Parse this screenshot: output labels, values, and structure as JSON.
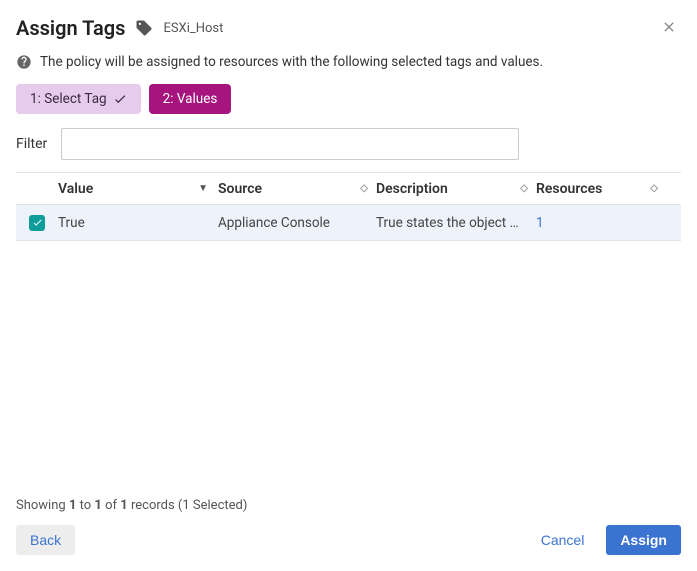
{
  "header": {
    "title": "Assign Tags",
    "tag_name": "ESXi_Host"
  },
  "hint": "The policy will be assigned to resources with the following selected tags and values.",
  "steps": {
    "step1_label": "1: Select Tag",
    "step2_label": "2: Values"
  },
  "filter": {
    "label": "Filter",
    "value": ""
  },
  "columns": {
    "value": "Value",
    "source": "Source",
    "description": "Description",
    "resources": "Resources"
  },
  "rows": [
    {
      "checked": true,
      "value": "True",
      "source": "Appliance Console",
      "description": "True states the object …",
      "resources": "1"
    }
  ],
  "status": {
    "from": "1",
    "to": "1",
    "total": "1",
    "selected": "1"
  },
  "buttons": {
    "back": "Back",
    "cancel": "Cancel",
    "assign": "Assign"
  }
}
